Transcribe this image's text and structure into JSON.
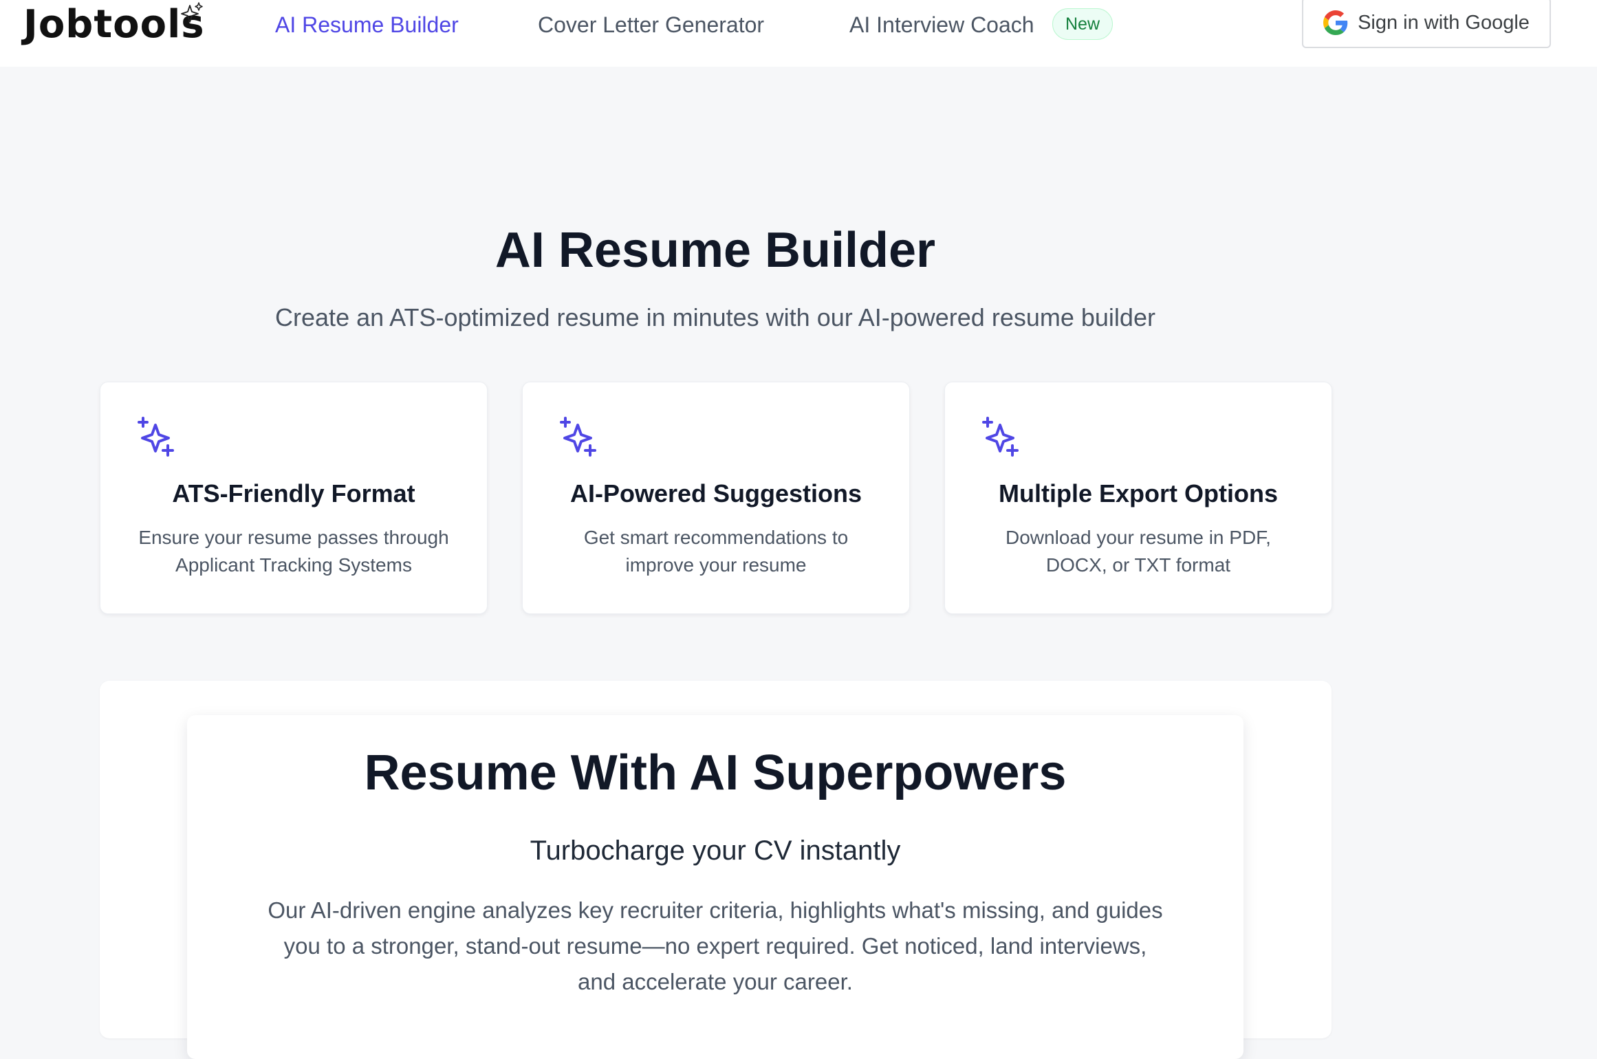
{
  "header": {
    "logo": "Jobtools",
    "nav": [
      {
        "label": "AI Resume Builder",
        "active": true
      },
      {
        "label": "Cover Letter Generator",
        "active": false
      },
      {
        "label": "AI Interview Coach",
        "active": false
      }
    ],
    "new_badge": "New",
    "signin_label": "Sign in with Google"
  },
  "hero": {
    "title": "AI Resume Builder",
    "subtitle": "Create an ATS-optimized resume in minutes with our AI-powered resume builder"
  },
  "features": [
    {
      "icon": "sparkles-icon",
      "title": "ATS-Friendly Format",
      "description": "Ensure your resume passes through Applicant Tracking Systems"
    },
    {
      "icon": "sparkles-icon",
      "title": "AI-Powered Suggestions",
      "description": "Get smart recommendations to improve your resume"
    },
    {
      "icon": "sparkles-icon",
      "title": "Multiple Export Options",
      "description": "Download your resume in PDF, DOCX, or TXT format"
    }
  ],
  "superpowers": {
    "title": "Resume With AI Superpowers",
    "tagline": "Turbocharge your CV instantly",
    "body": "Our AI-driven engine analyzes key recruiter criteria, highlights what's missing, and guides you to a stronger, stand-out resume—no expert required. Get noticed, land interviews, and accelerate your career."
  },
  "colors": {
    "accent": "#4f46e5",
    "page_background": "#f6f7f9",
    "heading": "#111827",
    "muted_text": "#4b5563",
    "badge_green": "#15803d"
  }
}
